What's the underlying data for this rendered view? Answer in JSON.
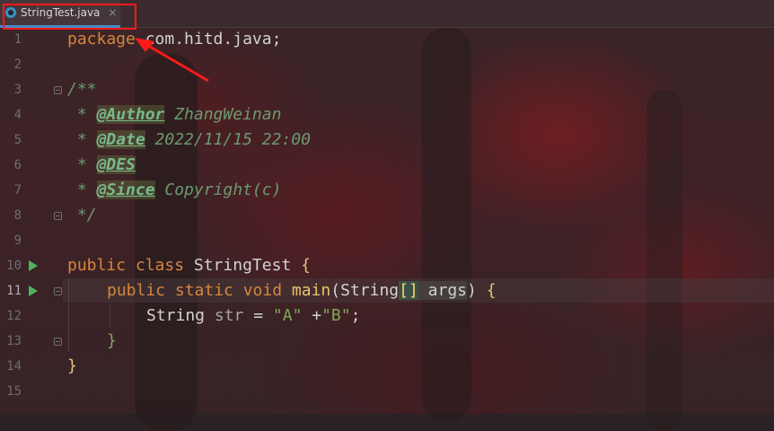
{
  "tab": {
    "icon": "java-class-icon",
    "label": "StringTest.java",
    "close_label": "×"
  },
  "colors": {
    "keyword": "#d7863f",
    "comment": "#6c9a6e",
    "string": "#7fa85c",
    "annotation": "#78b98b",
    "highlight": "#ff1a1a",
    "run": "#4fb35a"
  },
  "code": {
    "l1_kw": "package",
    "l1_rest": " com.hitd.java;",
    "l3": "/**",
    "l4_pre": " * ",
    "l4_tag": "@Author",
    "l4_val": " ZhangWeinan",
    "l5_pre": " * ",
    "l5_tag": "@Date",
    "l5_val": " 2022/11/15 22:00",
    "l6_pre": " * ",
    "l6_tag": "@DES",
    "l7_pre": " * ",
    "l7_tag": "@Since",
    "l7_val": " Copyright(c)",
    "l8": " */",
    "l10_kw": "public class",
    "l10_name": " StringTest ",
    "l10_brace": "{",
    "l11_kw": "public static void",
    "l11_fn": " main",
    "l11_open": "(String",
    "l11_brackets": "[]",
    "l11_args": " args",
    "l11_close": ") ",
    "l11_brace": "{",
    "l12_type": "String ",
    "l12_var": "str",
    "l12_eq": " = ",
    "l12_s1": "\"A\"",
    "l12_plus": " +",
    "l12_s2": "\"B\"",
    "l12_end": ";",
    "l13": "}",
    "l14": "}"
  },
  "line_numbers": [
    "1",
    "2",
    "3",
    "4",
    "5",
    "6",
    "7",
    "8",
    "9",
    "10",
    "11",
    "12",
    "13",
    "14",
    "15"
  ]
}
